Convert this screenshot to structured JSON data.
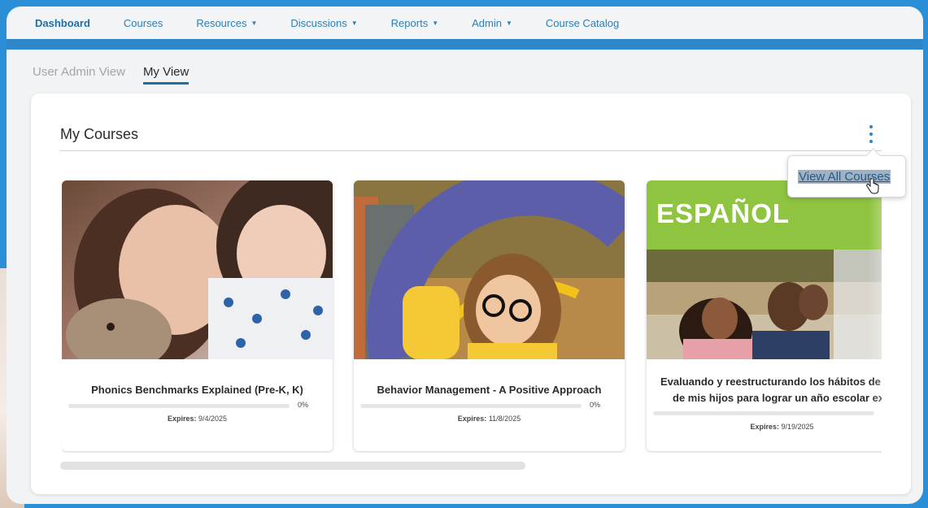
{
  "nav": {
    "items": [
      {
        "label": "Dashboard",
        "caret": false,
        "active": true
      },
      {
        "label": "Courses",
        "caret": false,
        "active": false
      },
      {
        "label": "Resources",
        "caret": true,
        "active": false
      },
      {
        "label": "Discussions",
        "caret": true,
        "active": false
      },
      {
        "label": "Reports",
        "caret": true,
        "active": false
      },
      {
        "label": "Admin",
        "caret": true,
        "active": false
      },
      {
        "label": "Course Catalog",
        "caret": false,
        "active": false
      }
    ]
  },
  "view_tabs": [
    {
      "label": "User Admin View",
      "active": false
    },
    {
      "label": "My View",
      "active": true
    }
  ],
  "panel": {
    "title": "My Courses",
    "menu_icon": "kebab-vertical-icon",
    "popover_link": "View All Courses"
  },
  "courses": [
    {
      "title": "Phonics Benchmarks Explained (Pre-K, K)",
      "progress": 0,
      "progress_label": "0%",
      "expires_label": "Expires:",
      "expires_date": "9/4/2025",
      "image": "children-with-stuffed-animal-photo"
    },
    {
      "title": "Behavior Management - A Positive Approach",
      "progress": 0,
      "progress_label": "0%",
      "expires_label": "Expires:",
      "expires_date": "11/8/2025",
      "image": "smiling-girl-with-glasses-photo"
    },
    {
      "title": "Evaluando y reestructurando los hábitos de es... de mis hijos para lograr un año escolar exitos...",
      "title_line1": "Evaluando y reestructurando los hábitos de es",
      "title_line2": "de mis hijos para lograr un año escolar exitos",
      "banner": "ESPAÑOL",
      "progress": 0,
      "expires_label": "Expires:",
      "expires_date": "9/19/2025",
      "image": "family-in-grocery-store-photo"
    }
  ],
  "colors": {
    "accent": "#2a87c9",
    "nav_text": "#2a7fb6",
    "banner_green": "#8fc440",
    "arc_purple": "#5c5eaa",
    "arc_yellow": "#f2c21b"
  }
}
